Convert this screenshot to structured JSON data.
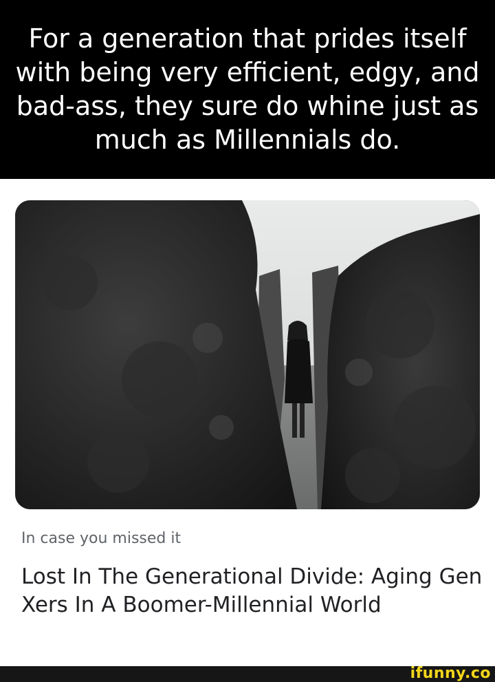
{
  "meme": {
    "caption": "For a generation that prides itself with being very efficient, edgy, and bad-ass, they sure do whine just as much as Millennials do."
  },
  "article": {
    "kicker": "In case you missed it",
    "headline": "Lost In The Generational Divide: Aging Gen Xers In A Boomer-Millennial World"
  },
  "watermark": {
    "text": "ifunny.co"
  },
  "colors": {
    "caption_bg": "#000000",
    "caption_text": "#ffffff",
    "kicker": "#5f6368",
    "headline": "#202124",
    "watermark": "#f2d61a"
  }
}
